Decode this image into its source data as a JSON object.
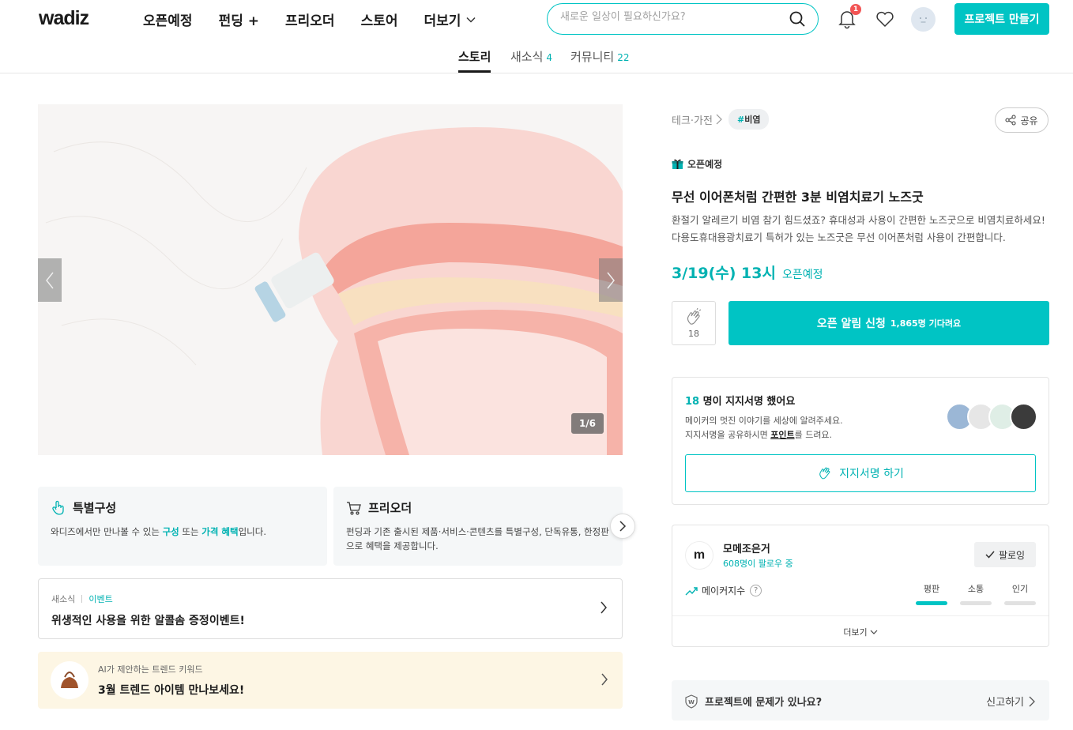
{
  "header": {
    "logo": "wadiz",
    "nav": [
      "오픈예정",
      "펀딩 +",
      "프리오더",
      "스토어",
      "더보기"
    ],
    "search_placeholder": "새로운 일상이 필요하신가요?",
    "notification_count": "1",
    "create_button": "프로젝트 만들기"
  },
  "tabs": [
    {
      "label": "스토리",
      "count": ""
    },
    {
      "label": "새소식",
      "count": "4"
    },
    {
      "label": "커뮤니티",
      "count": "22"
    }
  ],
  "hero": {
    "counter": "1/6"
  },
  "features": [
    {
      "title": "특별구성",
      "desc_pre": "와디즈에서만 만나볼 수 있는 ",
      "hl1": "구성",
      "mid": " 또는 ",
      "hl2": "가격 혜택",
      "desc_post": "입니다."
    },
    {
      "title": "프리오더",
      "desc": "펀딩과 기존 출시된 제품·서비스·콘텐츠를 특별구성, 단독유통, 한정판으로 혜택을 제공합니다."
    }
  ],
  "news": {
    "label": "새소식",
    "category": "이벤트",
    "title": "위생적인 사용을 위한 알콜솜 증정이벤트!"
  },
  "trend": {
    "sub": "AI가 제안하는 트렌드 키워드",
    "title": "3월 트렌드 아이템 만나보세요!"
  },
  "product": {
    "category": "테크·가전",
    "tag": "비염",
    "share": "공유",
    "status": "오픈예정",
    "title": "무선 이어폰처럼 간편한 3분 비염치료기 노즈굿",
    "desc": "환절기 알레르기 비염 참기 힘드셨죠? 휴대성과 사용이 간편한 노즈굿으로 비염치료하세요! 다용도휴대용광치료기 특허가 있는 노즈굿은 무선 이어폰처럼 사용이 간편합니다.",
    "open_date": "3/19(수) 13시",
    "open_status": "오픈예정",
    "clap_count": "18",
    "alarm_button": "오픈 알림 신청",
    "alarm_count": "1,865명 기다려요"
  },
  "support": {
    "count": "18",
    "head_suffix": " 명이 지지서명 했어요",
    "desc_line1": "메이커의 멋진 이야기를 세상에 알려주세요.",
    "desc_line2_pre": "지지서명을 공유하시면 ",
    "desc_point": "포인트",
    "desc_line2_post": "를 드려요.",
    "button": "지지서명 하기"
  },
  "maker": {
    "logo_text": "m",
    "name": "모메조은거",
    "followers": "608명이 팔로우 중",
    "follow_button": "팔로잉",
    "index_label": "메이커지수",
    "metrics": [
      {
        "label": "평판",
        "active": true
      },
      {
        "label": "소통",
        "active": false
      },
      {
        "label": "인기",
        "active": false
      }
    ],
    "more": "더보기"
  },
  "report": {
    "question": "프로젝트에 문제가 있나요?",
    "action": "신고하기"
  },
  "colors": {
    "accent": "#00c4c4",
    "badge": "#f25454"
  }
}
